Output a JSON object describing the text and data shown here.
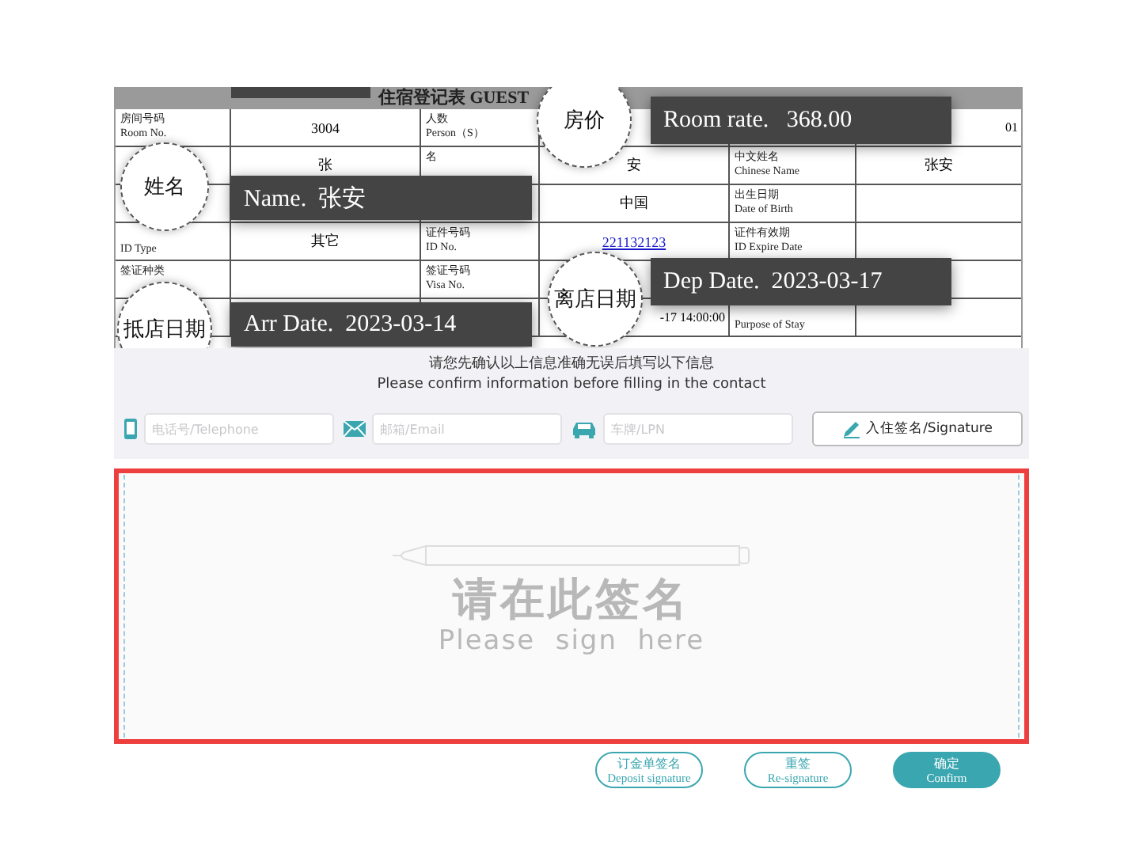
{
  "form": {
    "title": "住宿登记表 GUEST",
    "rows": [
      [
        {
          "label_zh": "房间号码",
          "label_en": "Room No.",
          "value": "3004",
          "kind": "text"
        },
        {
          "label_zh": "人数",
          "label_en": "Person（S）"
        },
        {
          "value": "01",
          "kind": "text"
        }
      ],
      [
        {
          "value": "张",
          "kind": "text"
        },
        {
          "label_zh": "名",
          "value": "安",
          "kind": "text"
        },
        {
          "label_zh": "中文姓名",
          "label_en": "Chinese Name",
          "value": "张安",
          "kind": "text"
        }
      ],
      [
        {},
        {
          "value": "中国",
          "kind": "text"
        },
        {
          "label_zh": "出生日期",
          "label_en": "Date of Birth"
        }
      ],
      [
        {
          "label_en": "ID Type",
          "value": "其它",
          "kind": "text"
        },
        {
          "label_zh": "证件号码",
          "label_en": "ID No.",
          "value": "221132123",
          "kind": "link"
        },
        {
          "label_zh": "证件有效期",
          "label_en": "ID Expire Date"
        }
      ],
      [
        {
          "label_zh": "签证种类"
        },
        {
          "label_zh": "签证号码",
          "label_en": "Visa No."
        },
        {}
      ],
      [
        {},
        {
          "value": "-17 14:00:00",
          "kind": "text"
        },
        {
          "label_en": "Purpose of Stay"
        }
      ]
    ]
  },
  "callouts": [
    {
      "tag": "房价",
      "text": "Room rate.   368.00"
    },
    {
      "tag": "姓名",
      "text": "Name.  张安"
    },
    {
      "tag": "离店日期",
      "text": "Dep Date.  2023-03-17"
    },
    {
      "tag": "抵店日期",
      "text": "Arr Date.  2023-03-14"
    }
  ],
  "notice": [
    "请您先确认以上信息准确无误后填写以下信息",
    "Please confirm information before filling in the contact"
  ],
  "contact_fields": [
    {
      "kind": "phone",
      "placeholder": "电话号/Telephone"
    },
    {
      "kind": "email",
      "placeholder": "邮箱/Email"
    },
    {
      "kind": "car",
      "placeholder": "车牌/LPN"
    }
  ],
  "signature_button": "入住签名/Signature",
  "sign_area": {
    "title": "请在此签名",
    "subtitle": "Please  sign  here"
  },
  "actions": [
    {
      "label_zh": "订金单签名",
      "label_en": "Deposit signature",
      "kind": "outline"
    },
    {
      "label_zh": "重签",
      "label_en": "Re-signature",
      "kind": "outline"
    },
    {
      "label_zh": "确定",
      "label_en": "Confirm",
      "kind": "filled"
    }
  ]
}
